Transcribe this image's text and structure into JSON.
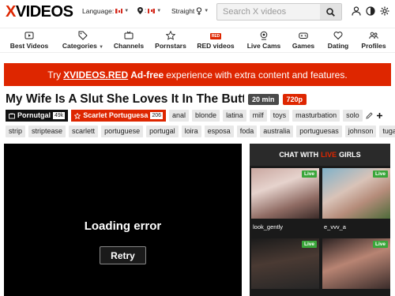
{
  "header": {
    "logo_x": "X",
    "logo_rest": "VIDEOS",
    "language_label": "Language:",
    "straight_label": "Straight",
    "search_placeholder": "Search X videos"
  },
  "nav": {
    "items": [
      {
        "label": "Best Videos",
        "icon": "play-box-icon"
      },
      {
        "label": "Categories",
        "icon": "tags-icon"
      },
      {
        "label": "Channels",
        "icon": "tv-icon"
      },
      {
        "label": "Pornstars",
        "icon": "star-icon"
      },
      {
        "label": "RED videos",
        "icon": "red-badge-icon",
        "badge": "RED"
      },
      {
        "label": "Live Cams",
        "icon": "webcam-icon"
      },
      {
        "label": "Games",
        "icon": "gamepad-icon"
      },
      {
        "label": "Dating",
        "icon": "hearts-icon"
      },
      {
        "label": "Profiles",
        "icon": "users-icon"
      }
    ]
  },
  "banner": {
    "pre": "Try",
    "brand": "XVIDEOS.RED",
    "bold": "Ad-free",
    "post": "experience with extra content and features."
  },
  "video": {
    "title": "My Wife Is A Slut She Loves It In The Butt",
    "duration": "20 min",
    "quality": "720p",
    "uploader": "Pornutgal",
    "uploader_count": "49k",
    "pornstar": "Scarlet Portuguesa",
    "pornstar_count": "206",
    "tags_row1": [
      "anal",
      "blonde",
      "latina",
      "milf",
      "toys",
      "masturbation",
      "solo"
    ],
    "tags_row2": [
      "strip",
      "striptease",
      "scarlett",
      "portuguese",
      "portugal",
      "loira",
      "esposa",
      "foda",
      "australia",
      "portuguesas",
      "johnson",
      "tuga"
    ]
  },
  "player": {
    "error_text": "Loading error",
    "retry_label": "Retry"
  },
  "live": {
    "head_pre": "CHAT WITH",
    "head_live": "LIVE",
    "head_post": "GIRLS",
    "badge": "Live",
    "cams": [
      {
        "name": "look_gently"
      },
      {
        "name": "e_vvv_a"
      },
      {
        "name": ""
      },
      {
        "name": ""
      }
    ]
  },
  "colors": {
    "brand_red": "#de2600",
    "live_green": "#3aa63a"
  }
}
